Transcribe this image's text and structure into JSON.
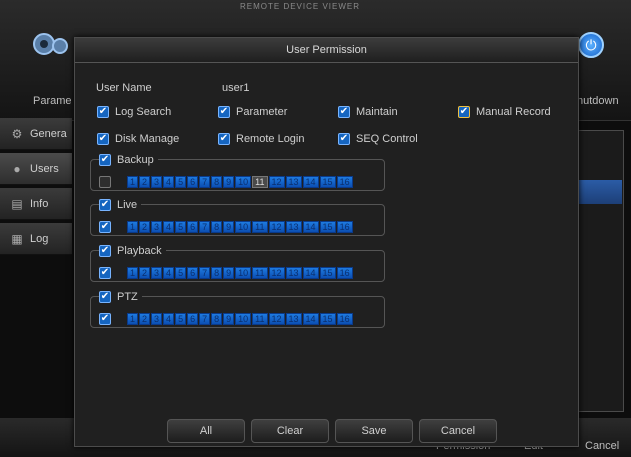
{
  "background": {
    "header_text": "REMOTE DEVICE VIEWER",
    "left_label": "Parame",
    "right_label": "hutdown",
    "sidebar": [
      {
        "label": "Genera",
        "icon": "gear-icon",
        "active": false
      },
      {
        "label": "Users",
        "icon": "user-icon",
        "active": true
      },
      {
        "label": "Info",
        "icon": "info-icon",
        "active": false
      },
      {
        "label": "Log",
        "icon": "log-icon",
        "active": false
      }
    ],
    "bottom": {
      "permission": "Permission",
      "edit": "Edit",
      "cancel": "Cancel"
    }
  },
  "dialog": {
    "title": "User Permission",
    "username_label": "User Name",
    "username_value": "user1",
    "permissions": [
      {
        "label": "Log Search",
        "checked": true
      },
      {
        "label": "Parameter",
        "checked": true
      },
      {
        "label": "Maintain",
        "checked": true
      },
      {
        "label": "Manual Record",
        "checked": true,
        "highlight": true
      },
      {
        "label": "Disk Manage",
        "checked": true
      },
      {
        "label": "Remote Login",
        "checked": true
      },
      {
        "label": "SEQ Control",
        "checked": true
      }
    ],
    "groups": [
      {
        "label": "Backup",
        "all_checked": false,
        "channels": [
          "1",
          "2",
          "3",
          "4",
          "5",
          "6",
          "7",
          "8",
          "9",
          "10",
          "11",
          "12",
          "13",
          "14",
          "15",
          "16"
        ],
        "off": [
          "11"
        ]
      },
      {
        "label": "Live",
        "all_checked": true,
        "channels": [
          "1",
          "2",
          "3",
          "4",
          "5",
          "6",
          "7",
          "8",
          "9",
          "10",
          "11",
          "12",
          "13",
          "14",
          "15",
          "16"
        ],
        "off": []
      },
      {
        "label": "Playback",
        "all_checked": true,
        "channels": [
          "1",
          "2",
          "3",
          "4",
          "5",
          "6",
          "7",
          "8",
          "9",
          "10",
          "11",
          "12",
          "13",
          "14",
          "15",
          "16"
        ],
        "off": []
      },
      {
        "label": "PTZ",
        "all_checked": true,
        "channels": [
          "1",
          "2",
          "3",
          "4",
          "5",
          "6",
          "7",
          "8",
          "9",
          "10",
          "11",
          "12",
          "13",
          "14",
          "15",
          "16"
        ],
        "off": []
      }
    ],
    "buttons": {
      "all": "All",
      "clear": "Clear",
      "save": "Save",
      "cancel": "Cancel"
    }
  }
}
